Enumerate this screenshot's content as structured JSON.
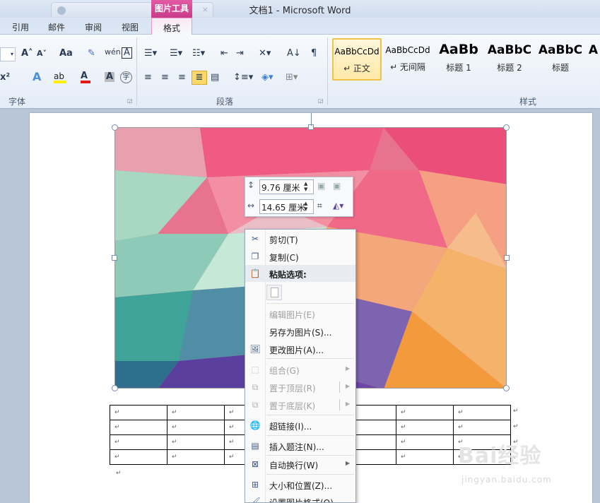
{
  "window": {
    "title": "文档1 - Microsoft Word",
    "context_tool": "图片工具",
    "background_tab": "",
    "background_tab_close": "×"
  },
  "ribbon_tabs": [
    "引用",
    "邮件",
    "审阅",
    "视图",
    "格式"
  ],
  "font_group": {
    "label": "字体",
    "grow": "A˄",
    "shrink": "A˅",
    "change_case": "Aa",
    "superscript": "x²",
    "char_border": "A",
    "char_shade": "A",
    "enclose": "字"
  },
  "paragraph_group": {
    "label": "段落"
  },
  "styles_group": {
    "label": "样式",
    "styles": [
      {
        "sample": "AaBbCcDd",
        "name": "↵ 正文",
        "selected": true
      },
      {
        "sample": "AaBbCcDd",
        "name": "↵ 无间隔",
        "selected": false
      },
      {
        "sample": "AaBb",
        "name": "标题 1",
        "selected": false
      },
      {
        "sample": "AaBbC",
        "name": "标题 2",
        "selected": false
      },
      {
        "sample": "AaBbC",
        "name": "标题",
        "selected": false
      },
      {
        "sample": "A",
        "name": "",
        "selected": false
      }
    ]
  },
  "mini_toolbar": {
    "height_value": "9.76 厘米",
    "width_value": "14.65 厘米"
  },
  "context_menu": {
    "items": [
      {
        "label": "剪切(T)",
        "icon": "scissors-icon",
        "enabled": true
      },
      {
        "label": "复制(C)",
        "icon": "copy-icon",
        "enabled": true
      },
      {
        "label": "粘贴选项:",
        "icon": "paste-icon",
        "enabled": true
      },
      {
        "label": "编辑图片(E)",
        "icon": "",
        "enabled": false
      },
      {
        "label": "另存为图片(S)...",
        "icon": "",
        "enabled": true
      },
      {
        "label": "更改图片(A)...",
        "icon": "change-picture-icon",
        "enabled": true
      },
      {
        "label": "组合(G)",
        "icon": "group-icon",
        "enabled": false,
        "submenu": true
      },
      {
        "label": "置于顶层(R)",
        "icon": "bring-front-icon",
        "enabled": false,
        "submenu": true
      },
      {
        "label": "置于底层(K)",
        "icon": "send-back-icon",
        "enabled": false,
        "submenu": true
      },
      {
        "label": "超链接(I)...",
        "icon": "hyperlink-icon",
        "enabled": true
      },
      {
        "label": "插入题注(N)...",
        "icon": "caption-icon",
        "enabled": true
      },
      {
        "label": "自动换行(W)",
        "icon": "wrap-text-icon",
        "enabled": true,
        "submenu": true
      },
      {
        "label": "大小和位置(Z)...",
        "icon": "size-position-icon",
        "enabled": true
      },
      {
        "label": "设置图片格式(O)...",
        "icon": "format-picture-icon",
        "enabled": true
      }
    ]
  },
  "table": {
    "rows": 4,
    "cols": 7,
    "cell_mark": "↵"
  },
  "watermark": {
    "main": "Bai经验",
    "url": "jingyan.baidu.com"
  },
  "colors": {
    "accent_tool": "#c93b8b",
    "selected_style": "#f0c24a"
  }
}
